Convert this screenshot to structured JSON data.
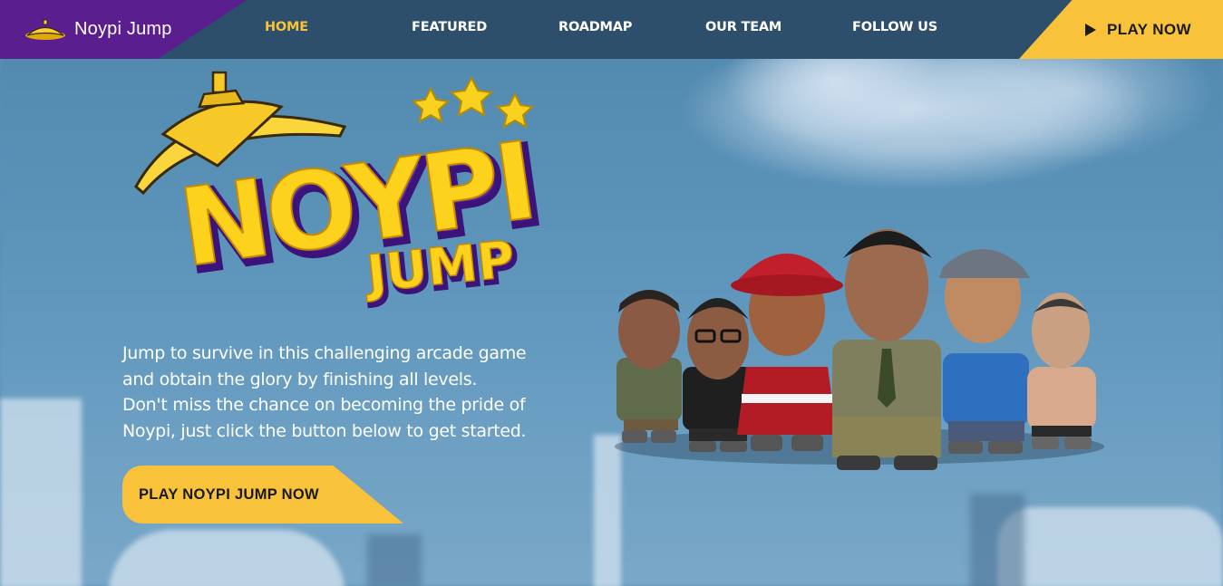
{
  "brand": {
    "name": "Noypi Jump",
    "icon": "salakot-hat-icon"
  },
  "nav": {
    "items": [
      {
        "label": "HOME",
        "active": true
      },
      {
        "label": "FEATURED",
        "active": false
      },
      {
        "label": "ROADMAP",
        "active": false
      },
      {
        "label": "OUR TEAM",
        "active": false
      },
      {
        "label": "FOLLOW US",
        "active": false
      }
    ],
    "play_now": "PLAY NOW",
    "play_icon": "play-triangle-icon"
  },
  "hero": {
    "logo_title": "NOYPI",
    "logo_subtitle": "JUMP",
    "description_lines": [
      "Jump to survive in this challenging arcade game",
      "and obtain the glory by finishing all levels.",
      "Don't miss the chance on becoming the pride of",
      "Noypi, just click the button below to get started."
    ],
    "cta": "PLAY NOYPI JUMP NOW"
  },
  "colors": {
    "brand_purple": "#5a1e8e",
    "accent_yellow": "#f8c33b",
    "nav_bg": "#2e4f6b",
    "active_nav": "#f7c23a",
    "sky": "#5a90b5"
  }
}
